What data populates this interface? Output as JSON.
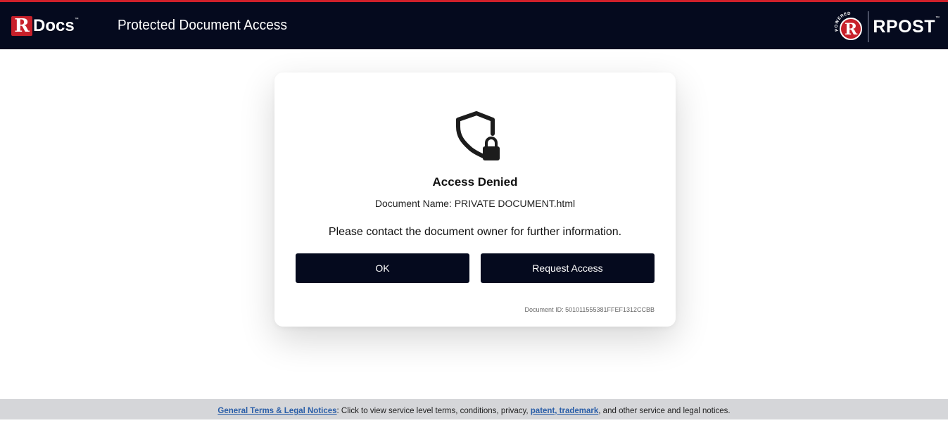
{
  "header": {
    "logo": {
      "r_letter": "R",
      "docs_text": "Docs",
      "tm": "™"
    },
    "title": "Protected Document Access",
    "powered_by": {
      "badge_text": "POWERED BY",
      "badge_letter": "R",
      "brand": "RPOST",
      "tm": "™"
    }
  },
  "card": {
    "icon": "shield-lock-icon",
    "heading": "Access Denied",
    "document_name": "Document Name: PRIVATE DOCUMENT.html",
    "message": "Please contact the document owner for further information.",
    "ok_label": "OK",
    "request_access_label": "Request Access",
    "document_id": "Document ID: 501011555381FFEF1312CCBB"
  },
  "footer": {
    "terms_link": "General Terms & Legal Notices",
    "text_before": ": Click to view service level terms, conditions, privacy, ",
    "patent_link": "patent, trademark",
    "text_after": ", and other service and legal notices."
  },
  "colors": {
    "header_bg": "#050a1e",
    "accent_red": "#c8202a",
    "button_bg": "#050a1e",
    "link": "#2a5ea8",
    "footer_bg": "#d5d6d9"
  }
}
